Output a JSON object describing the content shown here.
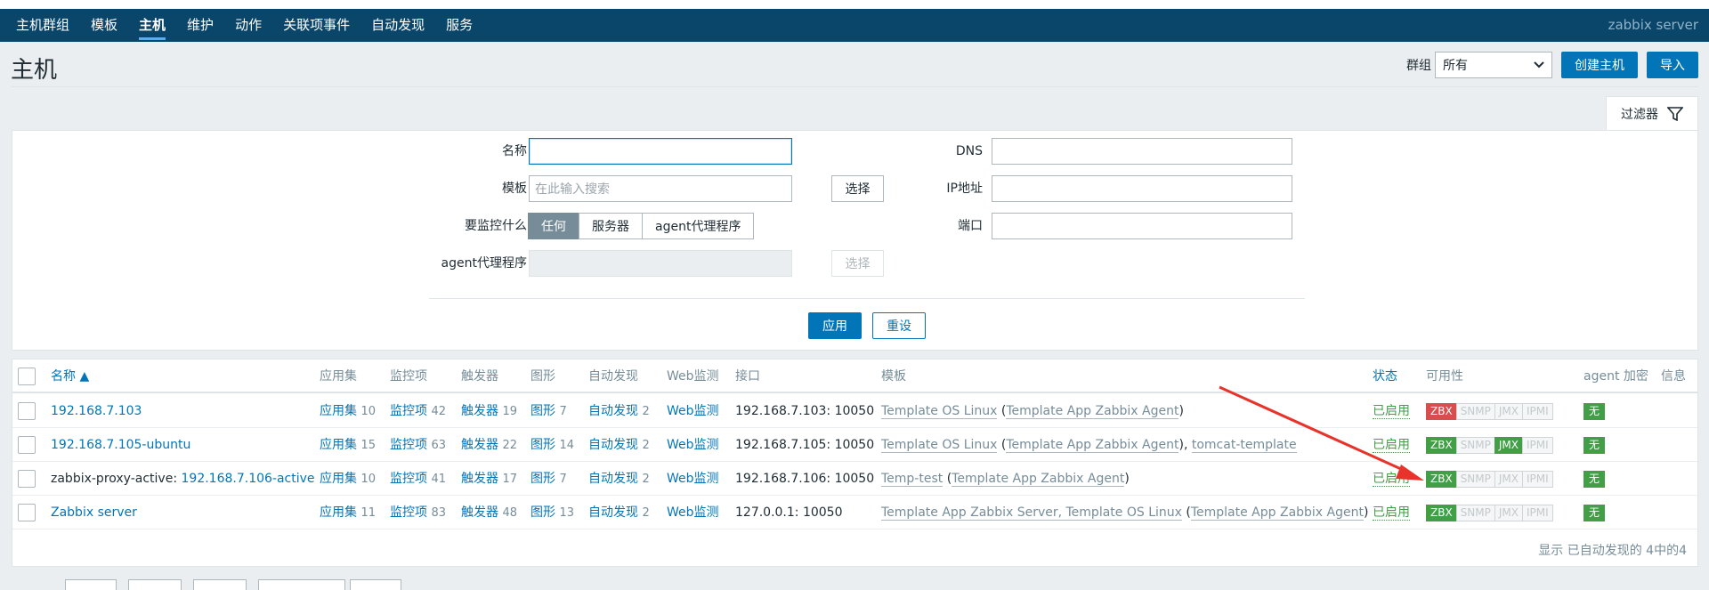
{
  "nav": {
    "items": [
      "主机群组",
      "模板",
      "主机",
      "维护",
      "动作",
      "关联项事件",
      "自动发现",
      "服务"
    ],
    "active_index": 2,
    "server_name": "zabbix server"
  },
  "header": {
    "title": "主机",
    "group_label": "群组",
    "group_value": "所有",
    "create_button": "创建主机",
    "import_button": "导入"
  },
  "filter": {
    "tab_label": "过滤器",
    "name_label": "名称",
    "name_value": "",
    "template_label": "模板",
    "template_placeholder": "在此输入搜索",
    "select_button": "选择",
    "monitored_by_label": "要监控什么",
    "monitored_by_options": [
      "任何",
      "服务器",
      "agent代理程序"
    ],
    "monitored_by_selected": 0,
    "proxy_label": "agent代理程序",
    "proxy_select_button": "选择",
    "dns_label": "DNS",
    "ip_label": "IP地址",
    "port_label": "端口",
    "apply_button": "应用",
    "reset_button": "重设"
  },
  "table": {
    "columns": {
      "name": "名称 ▲",
      "apps": "应用集",
      "items": "监控项",
      "triggers": "触发器",
      "graphs": "图形",
      "discovery": "自动发现",
      "web": "Web监测",
      "interface": "接口",
      "templates": "模板",
      "status": "状态",
      "availability": "可用性",
      "encryption": "agent 加密",
      "info": "信息"
    },
    "rows": [
      {
        "name_prefix": "",
        "name": "192.168.7.103",
        "apps_label": "应用集",
        "apps": "10",
        "items_label": "监控项",
        "items": "42",
        "triggers_label": "触发器",
        "triggers": "19",
        "graphs_label": "图形",
        "graphs": "7",
        "discovery_label": "自动发现",
        "discovery": "2",
        "web_label": "Web监测",
        "interface": "192.168.7.103: 10050",
        "template_main": "Template OS Linux",
        "template_paren": "Template App Zabbix Agent",
        "template_extra": "",
        "status": "已启用",
        "zbx": "red",
        "snmp": "gray",
        "jmx": "gray",
        "ipmi": "gray",
        "encryption": "无"
      },
      {
        "name_prefix": "",
        "name": "192.168.7.105-ubuntu",
        "apps_label": "应用集",
        "apps": "15",
        "items_label": "监控项",
        "items": "63",
        "triggers_label": "触发器",
        "triggers": "22",
        "graphs_label": "图形",
        "graphs": "14",
        "discovery_label": "自动发现",
        "discovery": "2",
        "web_label": "Web监测",
        "interface": "192.168.7.105: 10050",
        "template_main": "Template OS Linux",
        "template_paren": "Template App Zabbix Agent",
        "template_extra": "tomcat-template",
        "status": "已启用",
        "zbx": "green",
        "snmp": "gray",
        "jmx": "green",
        "ipmi": "gray",
        "encryption": "无"
      },
      {
        "name_prefix": "zabbix-proxy-active:",
        "name": "192.168.7.106-active",
        "apps_label": "应用集",
        "apps": "10",
        "items_label": "监控项",
        "items": "41",
        "triggers_label": "触发器",
        "triggers": "17",
        "graphs_label": "图形",
        "graphs": "7",
        "discovery_label": "自动发现",
        "discovery": "2",
        "web_label": "Web监测",
        "interface": "192.168.7.106: 10050",
        "template_main": "Temp-test",
        "template_paren": "Template App Zabbix Agent",
        "template_extra": "",
        "status": "已启用",
        "zbx": "green",
        "snmp": "gray",
        "jmx": "gray",
        "ipmi": "gray",
        "encryption": "无"
      },
      {
        "name_prefix": "",
        "name": "Zabbix server",
        "apps_label": "应用集",
        "apps": "11",
        "items_label": "监控项",
        "items": "83",
        "triggers_label": "触发器",
        "triggers": "48",
        "graphs_label": "图形",
        "graphs": "13",
        "discovery_label": "自动发现",
        "discovery": "2",
        "web_label": "Web监测",
        "interface": "127.0.0.1: 10050",
        "template_main": "Template App Zabbix Server, Template OS Linux",
        "template_paren": "Template App Zabbix Agent",
        "template_extra": "",
        "status": "已启用",
        "zbx": "green",
        "snmp": "gray",
        "jmx": "gray",
        "ipmi": "gray",
        "encryption": "无"
      }
    ],
    "availability_labels": [
      "ZBX",
      "SNMP",
      "JMX",
      "IPMI"
    ],
    "footer": "显示 已自动发现的 4中的4"
  },
  "colors": {
    "nav_bg": "#0a466a",
    "link": "#0275b8",
    "green": "#429e47",
    "red": "#d64e4e",
    "annotation_arrow": "#e8322a"
  }
}
